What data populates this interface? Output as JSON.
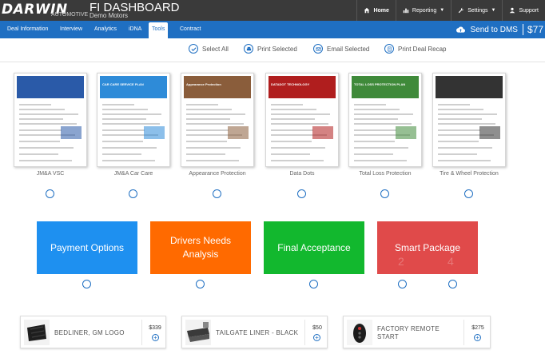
{
  "header": {
    "logo": "DARWIN",
    "logo_sub": "AUTOMOTIVE",
    "title": "FI DASHBOARD",
    "subtitle": "Demo Motors",
    "nav": [
      {
        "label": "Home",
        "icon": "home-icon"
      },
      {
        "label": "Reporting",
        "icon": "bar-chart-icon"
      },
      {
        "label": "Settings",
        "icon": "wrench-icon"
      },
      {
        "label": "Support",
        "icon": "user-icon"
      }
    ]
  },
  "tabs": [
    {
      "label": "Deal Information"
    },
    {
      "label": "Interview"
    },
    {
      "label": "Analytics"
    },
    {
      "label": "iDNA"
    },
    {
      "label": "Tools",
      "active": true
    },
    {
      "label": "Contract"
    }
  ],
  "send_dms": {
    "label": "Send to DMS",
    "amount": "$77"
  },
  "actions": [
    {
      "label": "Select All",
      "icon": "check-icon"
    },
    {
      "label": "Print Selected",
      "icon": "printer-icon"
    },
    {
      "label": "Email Selected",
      "icon": "envelope-icon"
    },
    {
      "label": "Print Deal Recap",
      "icon": "document-icon"
    }
  ],
  "brochures": [
    {
      "label": "JM&A VSC",
      "accent": "#2a5aa8",
      "hero_title": ""
    },
    {
      "label": "JM&A Car Care",
      "accent": "#2e8bd8",
      "hero_title": "CAR CARE SERVICE PLAN"
    },
    {
      "label": "Appearance Protection",
      "accent": "#8a5d3b",
      "hero_title": "Appearance Protection"
    },
    {
      "label": "Data Dots",
      "accent": "#b01e1e",
      "hero_title": "DATADOT TECHNOLOGY"
    },
    {
      "label": "Total Loss Protection",
      "accent": "#3f8a3a",
      "hero_title": "TOTAL LOSS PROTECTION PLAN"
    },
    {
      "label": "Tire & Wheel Protection",
      "accent": "#333333",
      "hero_title": ""
    }
  ],
  "packages": [
    {
      "label": "Payment Options",
      "color": "#1e90f0"
    },
    {
      "label": "Drivers Needs Analysis",
      "color": "#ff6a00"
    },
    {
      "label": "Final Acceptance",
      "color": "#12b82e"
    },
    {
      "label": "Smart Package",
      "color": "#e04a4a",
      "faint": [
        "2",
        "4"
      ]
    }
  ],
  "accessories": [
    {
      "name": "BEDLINER, GM LOGO",
      "price": "$339",
      "icon": "bedliner-icon"
    },
    {
      "name": "TAILGATE LINER - BLACK",
      "price": "$50",
      "icon": "tailgate-liner-icon"
    },
    {
      "name": "FACTORY REMOTE START",
      "price": "$275",
      "icon": "key-fob-icon"
    }
  ]
}
